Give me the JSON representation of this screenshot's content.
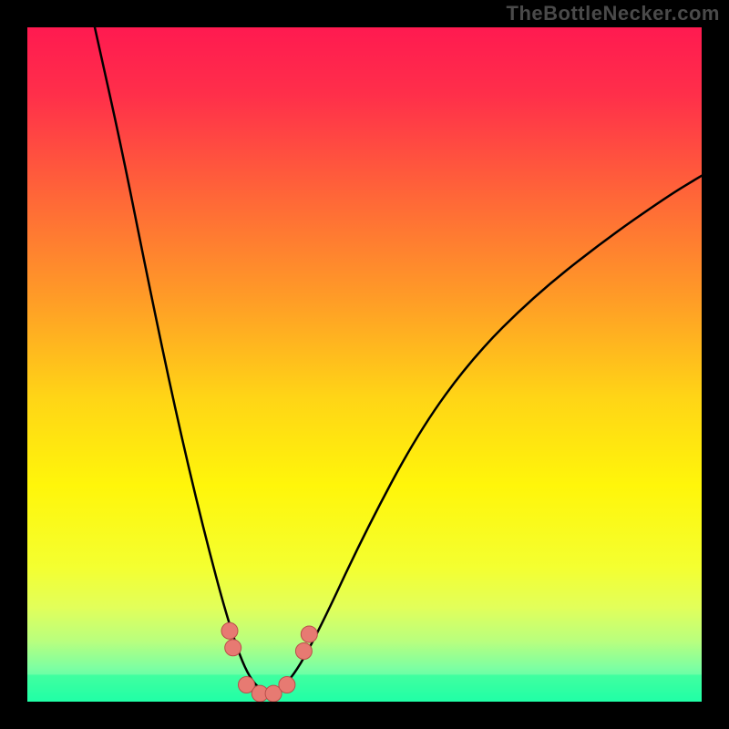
{
  "watermark": "TheBottleNecker.com",
  "chart_data": {
    "type": "line",
    "title": "",
    "xlabel": "",
    "ylabel": "",
    "xlim": [
      0,
      100
    ],
    "ylim": [
      0,
      100
    ],
    "note": "No axis labels or tick marks are visible in the image. X and Y values below are normalized to a 0–100 plot-area coordinate system. The curve is a V-shaped bottleneck profile with its minimum near x≈35, rising steeply left and more shallowly right. Eight salmon data points sit clustered near the trough.",
    "gradient_stops": [
      {
        "offset": 0.0,
        "color": "#ff1a50"
      },
      {
        "offset": 0.1,
        "color": "#ff2f4a"
      },
      {
        "offset": 0.25,
        "color": "#ff6638"
      },
      {
        "offset": 0.4,
        "color": "#ff9b27"
      },
      {
        "offset": 0.55,
        "color": "#ffd516"
      },
      {
        "offset": 0.68,
        "color": "#fff60a"
      },
      {
        "offset": 0.8,
        "color": "#f4ff30"
      },
      {
        "offset": 0.86,
        "color": "#e2ff5a"
      },
      {
        "offset": 0.91,
        "color": "#b9ff7e"
      },
      {
        "offset": 0.95,
        "color": "#7dffa2"
      },
      {
        "offset": 1.0,
        "color": "#22ffb4"
      }
    ],
    "curve": [
      {
        "x": 10,
        "y": 100
      },
      {
        "x": 14,
        "y": 82
      },
      {
        "x": 18,
        "y": 62
      },
      {
        "x": 22,
        "y": 43
      },
      {
        "x": 26,
        "y": 26
      },
      {
        "x": 30,
        "y": 11
      },
      {
        "x": 33,
        "y": 3
      },
      {
        "x": 36,
        "y": 1
      },
      {
        "x": 39,
        "y": 3
      },
      {
        "x": 43,
        "y": 10
      },
      {
        "x": 50,
        "y": 25
      },
      {
        "x": 58,
        "y": 40
      },
      {
        "x": 66,
        "y": 51
      },
      {
        "x": 75,
        "y": 60
      },
      {
        "x": 85,
        "y": 68
      },
      {
        "x": 95,
        "y": 75
      },
      {
        "x": 100,
        "y": 78
      }
    ],
    "scatter_points": [
      {
        "x": 30.0,
        "y": 10.5
      },
      {
        "x": 30.5,
        "y": 8.0
      },
      {
        "x": 32.5,
        "y": 2.5
      },
      {
        "x": 34.5,
        "y": 1.2
      },
      {
        "x": 36.5,
        "y": 1.2
      },
      {
        "x": 38.5,
        "y": 2.5
      },
      {
        "x": 41.0,
        "y": 7.5
      },
      {
        "x": 41.8,
        "y": 10.0
      }
    ],
    "green_band": {
      "y_from": 0,
      "y_to": 4
    },
    "colors": {
      "curve": "#000000",
      "point_fill": "#e77a72",
      "point_stroke": "#b94e4a"
    }
  }
}
